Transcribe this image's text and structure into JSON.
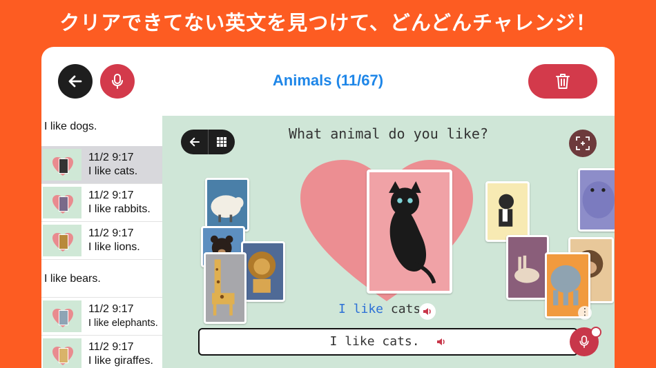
{
  "banner": {
    "text": "クリアできてない英文を見つけて、どんどんチャレンジ！"
  },
  "header": {
    "title": "Animals (11/67)"
  },
  "list": {
    "sections": [
      {
        "header": "I like dogs.",
        "rows": [
          {
            "date": "11/2 9:17",
            "text": "I like cats.",
            "selected": true
          },
          {
            "date": "11/2 9:17",
            "text": "I like rabbits.",
            "selected": false
          },
          {
            "date": "11/2 9:17",
            "text": "I like lions.",
            "selected": false
          }
        ]
      },
      {
        "header": "I like bears.",
        "rows": [
          {
            "date": "11/2 9:17",
            "text": "I like elephants.",
            "selected": false
          },
          {
            "date": "11/2 9:17",
            "text": "I like giraffes.",
            "selected": false
          }
        ]
      }
    ]
  },
  "scene": {
    "question": "What animal do you like?",
    "caption_part1": "I like",
    "caption_part2": " cats.",
    "answer_text": "I like cats."
  },
  "colors": {
    "brand_orange": "#fd5c22",
    "accent_red": "#d33a4b",
    "title_blue": "#1e86e8",
    "scene_bg": "#cfe6d7"
  },
  "icons": [
    "back-arrow-icon",
    "microphone-icon",
    "trash-icon",
    "grid-icon",
    "zoom-frame-icon",
    "speaker-icon"
  ]
}
